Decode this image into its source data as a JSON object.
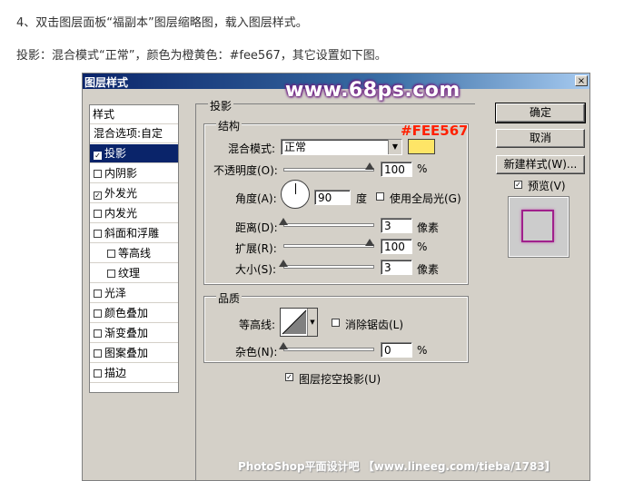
{
  "article": {
    "step": "4、双击图层面板“福副本”图层缩略图，载入图层样式。",
    "desc": "投影：混合模式“正常”，颜色为橙黄色：#fee567，其它设置如下图。"
  },
  "dialog": {
    "title": "图层样式",
    "close": "×",
    "watermark": "www.68ps.com",
    "annotation": "#FEE567",
    "list_header": "样式",
    "list_items": [
      {
        "label": "混合选项:自定",
        "checkbox": false,
        "checked": false,
        "selected": false
      },
      {
        "label": "投影",
        "checkbox": true,
        "checked": true,
        "selected": true
      },
      {
        "label": "内阴影",
        "checkbox": true,
        "checked": false,
        "selected": false
      },
      {
        "label": "外发光",
        "checkbox": true,
        "checked": true,
        "selected": false
      },
      {
        "label": "内发光",
        "checkbox": true,
        "checked": false,
        "selected": false
      },
      {
        "label": "斜面和浮雕",
        "checkbox": true,
        "checked": false,
        "selected": false
      },
      {
        "label": "等高线",
        "checkbox": true,
        "checked": false,
        "selected": false,
        "indent": true
      },
      {
        "label": "纹理",
        "checkbox": true,
        "checked": false,
        "selected": false,
        "indent": true
      },
      {
        "label": "光泽",
        "checkbox": true,
        "checked": false,
        "selected": false
      },
      {
        "label": "颜色叠加",
        "checkbox": true,
        "checked": false,
        "selected": false
      },
      {
        "label": "渐变叠加",
        "checkbox": true,
        "checked": false,
        "selected": false
      },
      {
        "label": "图案叠加",
        "checkbox": true,
        "checked": false,
        "selected": false
      },
      {
        "label": "描边",
        "checkbox": true,
        "checked": false,
        "selected": false
      }
    ],
    "section_title": "投影",
    "structure": {
      "legend": "结构",
      "blend_label": "混合模式:",
      "blend_value": "正常",
      "color": "#fee567",
      "opacity_label": "不透明度(O):",
      "opacity_value": "100",
      "opacity_fraction": 1.0,
      "angle_label": "角度(A):",
      "angle_value": "90",
      "angle_unit": "度",
      "global_light_label": "使用全局光(G)",
      "distance_label": "距离(D):",
      "distance_value": "3",
      "distance_fraction": 0.0,
      "spread_label": "扩展(R):",
      "spread_value": "100",
      "spread_fraction": 1.0,
      "size_label": "大小(S):",
      "size_value": "3",
      "size_fraction": 0.0,
      "percent": "%",
      "px": "像素"
    },
    "quality": {
      "legend": "品质",
      "contour_label": "等高线:",
      "antialias_label": "消除锯齿(L)",
      "noise_label": "杂色(N):",
      "noise_value": "0",
      "noise_fraction": 0.0,
      "percent": "%"
    },
    "knockout_label": "图层挖空投影(U)",
    "buttons": {
      "ok": "确定",
      "cancel": "取消",
      "new_style": "新建样式(W)...",
      "preview": "预览(V)"
    }
  },
  "footer": "PhotoShop平面设计吧 【www.lineeg.com/tieba/1783】",
  "colors": {
    "title_start": "#0a246a",
    "title_end": "#a6caf0",
    "dialog_bg": "#d4d0c8",
    "preview_border": "#a0208c"
  }
}
